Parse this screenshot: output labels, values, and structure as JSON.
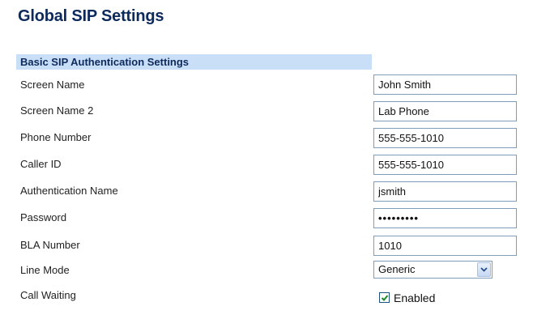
{
  "page": {
    "title": "Global SIP Settings"
  },
  "section": {
    "header": "Basic SIP Authentication Settings"
  },
  "fields": {
    "screen_name": {
      "label": "Screen Name",
      "value": "John Smith"
    },
    "screen_name_2": {
      "label": "Screen Name 2",
      "value": "Lab Phone"
    },
    "phone_number": {
      "label": "Phone Number",
      "value": "555-555-1010"
    },
    "caller_id": {
      "label": "Caller ID",
      "value": "555-555-1010"
    },
    "authentication_name": {
      "label": "Authentication Name",
      "value": "jsmith"
    },
    "password": {
      "label": "Password",
      "value": "•••••••••"
    },
    "bla_number": {
      "label": "BLA Number",
      "value": "1010"
    },
    "line_mode": {
      "label": "Line Mode",
      "selected": "Generic",
      "icon": "chevron-down-icon"
    },
    "call_waiting": {
      "label": "Call Waiting",
      "checked": true,
      "option_label": "Enabled",
      "icon": "checkmark-icon"
    }
  },
  "colors": {
    "title": "#0d2a5c",
    "section_header_bg": "#c9def7",
    "input_border": "#7f9db9",
    "checkbox_check": "#1f8a2d"
  }
}
